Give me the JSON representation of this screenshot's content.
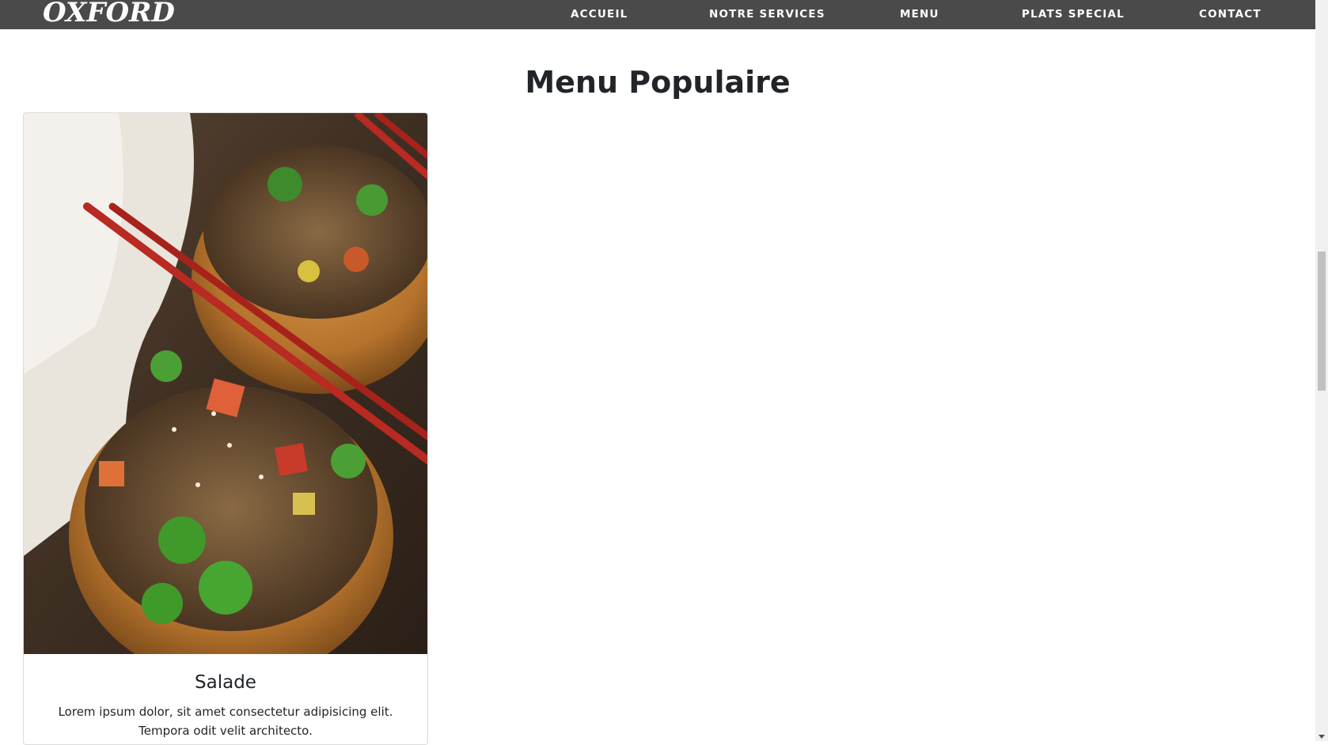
{
  "navbar": {
    "brand": "OXFORD",
    "links": [
      {
        "label": "ACCUEIL"
      },
      {
        "label": "NOTRE SERVICES"
      },
      {
        "label": "MENU"
      },
      {
        "label": "PLATS SPECIAL"
      },
      {
        "label": "CONTACT"
      }
    ]
  },
  "section": {
    "title": "Menu Populaire"
  },
  "cards": [
    {
      "title": "Salade",
      "text": "Lorem ipsum dolor, sit amet consectetur adipisicing elit. Tempora odit velit architecto."
    }
  ],
  "colors": {
    "navbar_bg": "#4a4a4a",
    "text_dark": "#212529",
    "scrollbar_thumb": "#c1c1c1"
  }
}
